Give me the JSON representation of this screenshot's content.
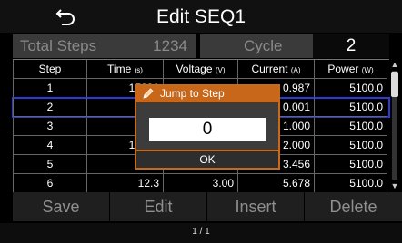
{
  "header": {
    "title": "Edit SEQ1",
    "back_icon": "back-arrow-icon"
  },
  "summary": {
    "total_steps_label": "Total Steps",
    "total_steps_value": "1234",
    "cycle_label": "Cycle",
    "cycle_value": "2"
  },
  "table": {
    "columns": [
      {
        "label": "Step",
        "unit": ""
      },
      {
        "label": "Time",
        "unit": "(s)"
      },
      {
        "label": "Voltage",
        "unit": "(V)"
      },
      {
        "label": "Current",
        "unit": "(A)"
      },
      {
        "label": "Power",
        "unit": "(W)"
      }
    ],
    "rows": [
      {
        "step": "1",
        "time": "17280",
        "voltage": "",
        "current": "0.987",
        "power": "5100.0"
      },
      {
        "step": "2",
        "time": "",
        "voltage": "",
        "current": "0.001",
        "power": "5100.0"
      },
      {
        "step": "3",
        "time": "",
        "voltage": "",
        "current": "1.000",
        "power": "5100.0"
      },
      {
        "step": "4",
        "time": "12345",
        "voltage": "",
        "current": "2.000",
        "power": "5100.0"
      },
      {
        "step": "5",
        "time": "",
        "voltage": "",
        "current": "3.456",
        "power": "5100.0"
      },
      {
        "step": "6",
        "time": "12.3",
        "voltage": "3.00",
        "current": "5.678",
        "power": "5100.0"
      }
    ],
    "selected_step": "2"
  },
  "scrollbar": {
    "position_fraction": 0.0
  },
  "dialog": {
    "title": "Jump to Step",
    "input_value": "0",
    "ok_label": "OK",
    "icon": "pencil-icon",
    "accent_color": "#c8661a"
  },
  "toolbar": {
    "save_label": "Save",
    "edit_label": "Edit",
    "insert_label": "Insert",
    "delete_label": "Delete"
  },
  "footer": {
    "page_indicator": "1 / 1"
  },
  "colors": {
    "selection_outline": "#2d3bd6",
    "background": "#000000"
  }
}
